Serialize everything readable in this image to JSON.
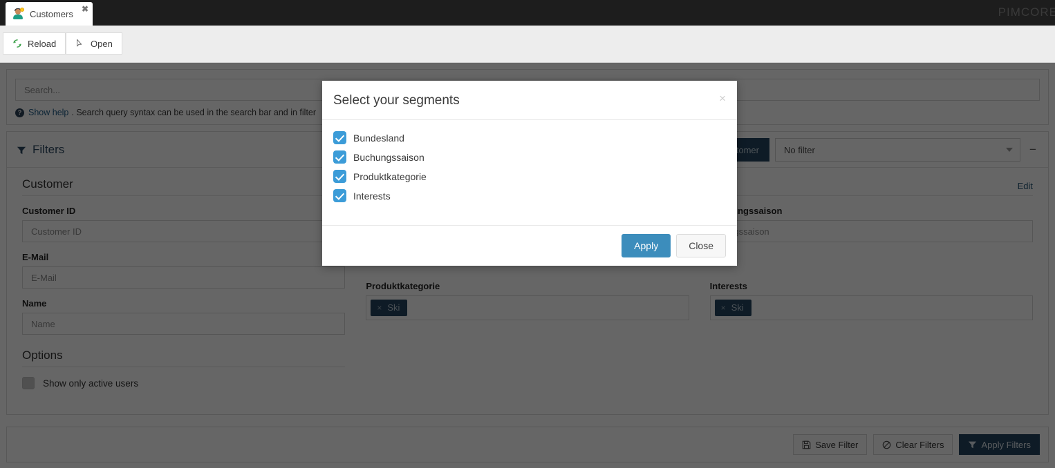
{
  "window": {
    "brand": "PIMCORE",
    "tab": {
      "label": "Customers",
      "icon": "customer-person-icon",
      "close": "✖"
    }
  },
  "toolbar": {
    "reload_label": "Reload",
    "open_label": "Open"
  },
  "search": {
    "placeholder": "Search...",
    "value": "",
    "help_link": "Show help",
    "help_text": ". Search query syntax can be used in the search bar and in filter"
  },
  "filters": {
    "title": "Filters",
    "customer_button": "stomer",
    "filter_select_value": "No filter",
    "minus_label": "−",
    "edit_link": "Edit"
  },
  "customer_section": {
    "title": "Customer",
    "fields": [
      {
        "label": "Customer ID",
        "placeholder": "Customer ID",
        "value": ""
      },
      {
        "label": "E-Mail",
        "placeholder": "E-Mail",
        "value": ""
      },
      {
        "label": "Name",
        "placeholder": "Name",
        "value": ""
      }
    ]
  },
  "segment_fields": {
    "buchungssaison": {
      "label": "Buchungssaison",
      "placeholder": "hungssaison"
    },
    "produktkategorie": {
      "label": "Produktkategorie",
      "tags": [
        "Ski"
      ]
    },
    "interests": {
      "label": "Interests",
      "tags": [
        "Ski"
      ]
    }
  },
  "options": {
    "title": "Options",
    "active_users_label": "Show only active users",
    "active_users_checked": false
  },
  "footer": {
    "save_filter": "Save Filter",
    "clear_filters": "Clear Filters",
    "apply_filters": "Apply Filters"
  },
  "modal": {
    "title": "Select your segments",
    "close_glyph": "×",
    "segments": [
      {
        "label": "Bundesland",
        "checked": true
      },
      {
        "label": "Buchungssaison",
        "checked": true
      },
      {
        "label": "Produktkategorie",
        "checked": true
      },
      {
        "label": "Interests",
        "checked": true
      }
    ],
    "apply_label": "Apply",
    "close_label": "Close"
  },
  "colors": {
    "accent_blue": "#3c8dbc",
    "checkbox_blue": "#3c9cd8",
    "dark_navy": "#23455f",
    "topbar": "#1d1d1d"
  }
}
